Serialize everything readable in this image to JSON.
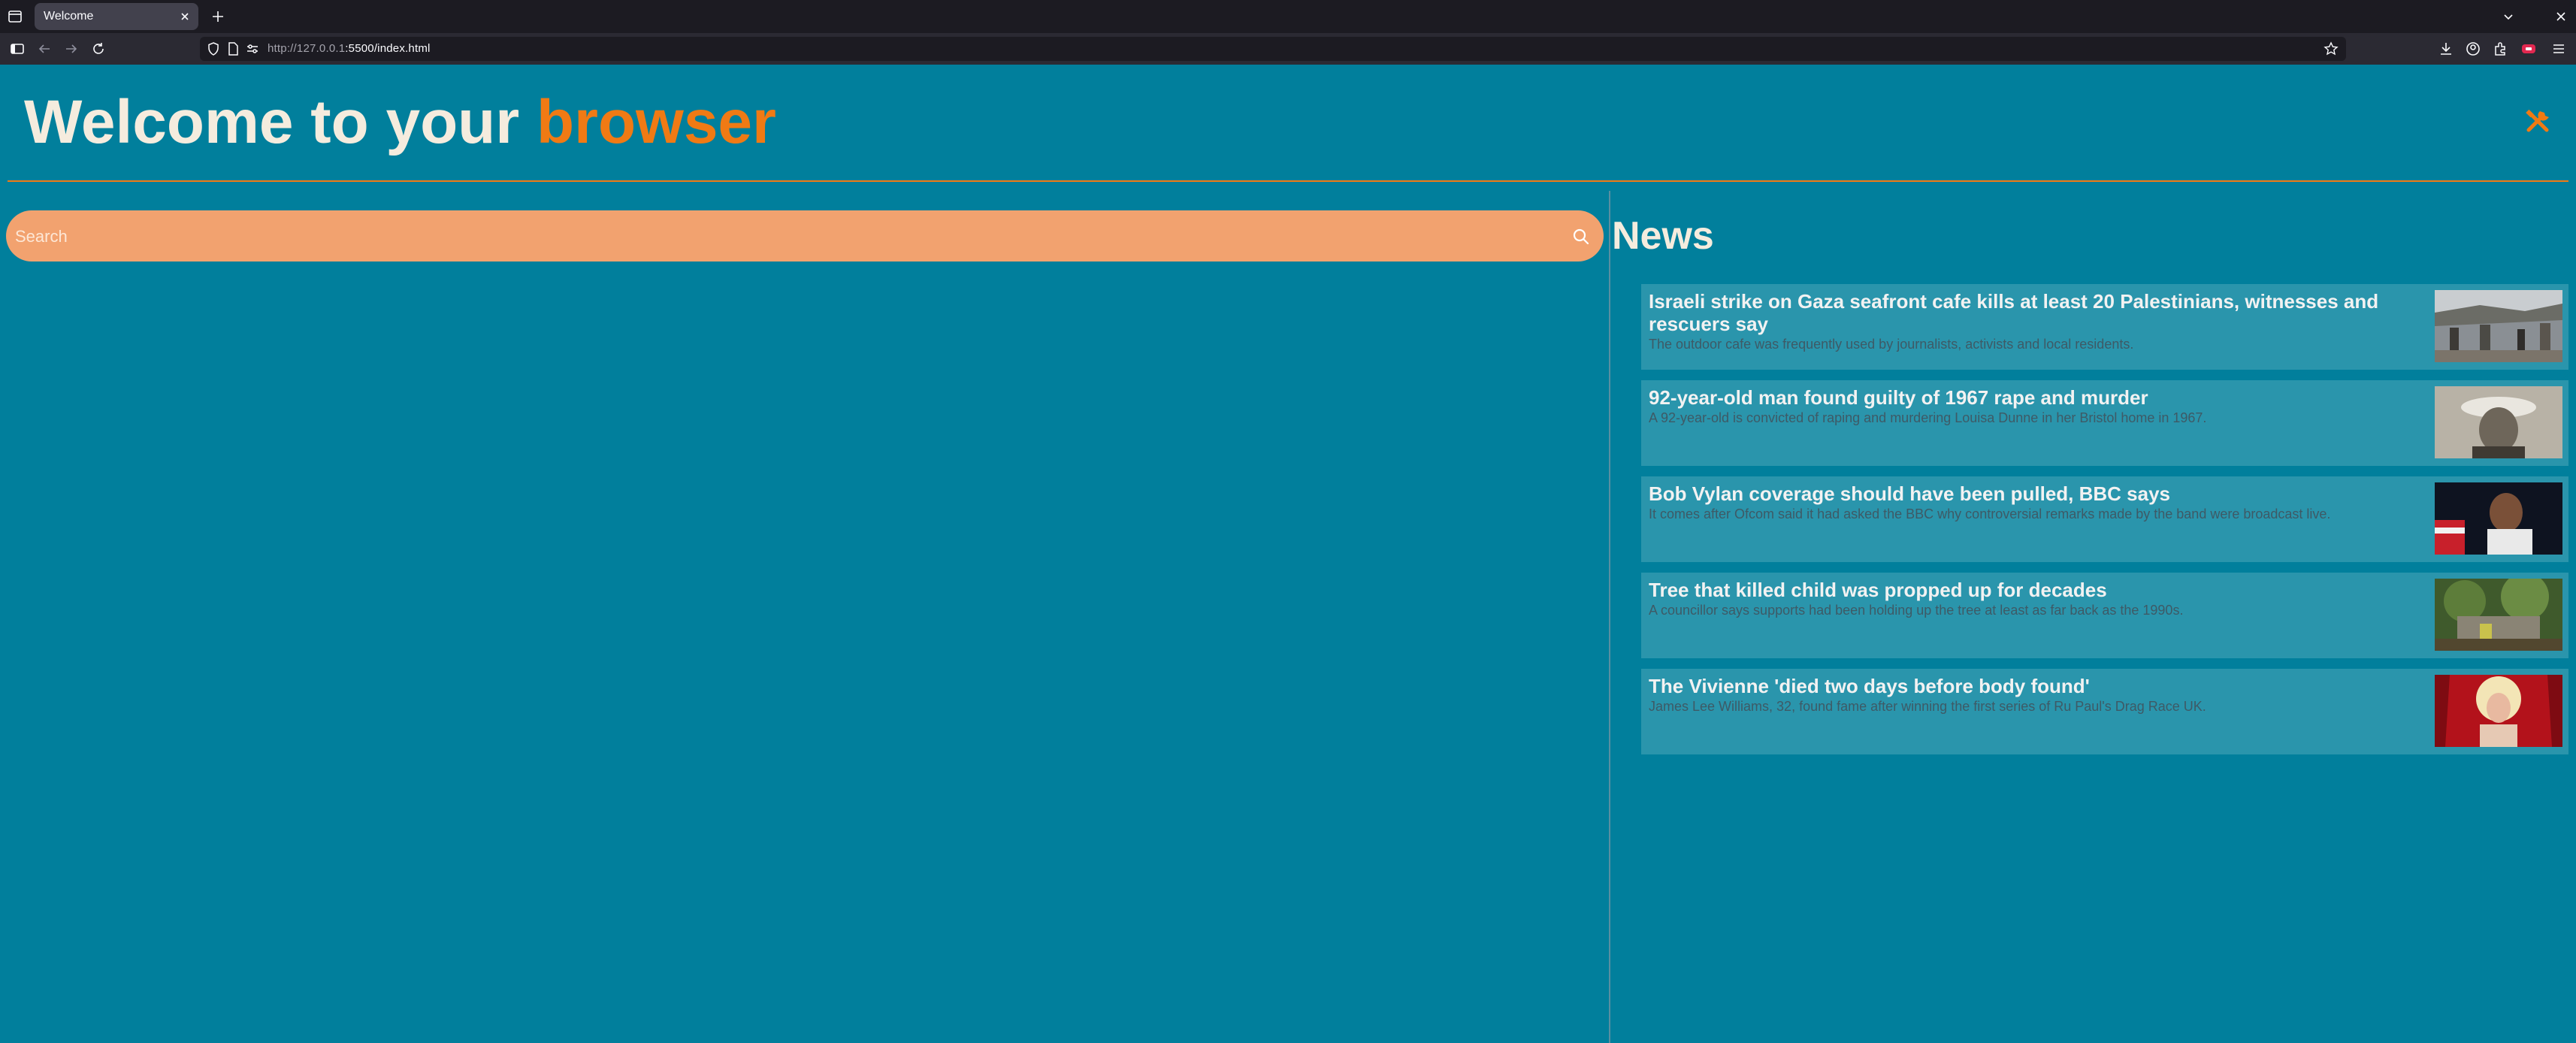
{
  "browser": {
    "tab_title": "Welcome",
    "url_host": "http://127.0.0.1",
    "url_rest": ":5500/index.html"
  },
  "header": {
    "title_prefix": "Welcome to your ",
    "title_accent": "browser"
  },
  "search": {
    "placeholder": "Search",
    "value": ""
  },
  "news": {
    "title": "News",
    "items": [
      {
        "headline": "Israeli strike on Gaza seafront cafe kills at least 20 Palestinians, witnesses and rescuers say",
        "summary": "The outdoor cafe was frequently used by journalists, activists and local residents."
      },
      {
        "headline": "92-year-old man found guilty of 1967 rape and murder",
        "summary": "A 92-year-old is convicted of raping and murdering Louisa Dunne in her Bristol home in 1967."
      },
      {
        "headline": "Bob Vylan coverage should have been pulled, BBC says",
        "summary": "It comes after Ofcom said it had asked the BBC why controversial remarks made by the band were broadcast live."
      },
      {
        "headline": "Tree that killed child was propped up for decades",
        "summary": "A councillor says supports had been holding up the tree at least as far back as the 1990s."
      },
      {
        "headline": "The Vivienne 'died two days before body found'",
        "summary": "James Lee Williams, 32, found fame after winning the first series of Ru Paul's Drag Race UK."
      }
    ]
  },
  "colors": {
    "page_bg": "#017f9c",
    "accent": "#f07a14",
    "search_bg": "#f2a26f",
    "card_bg": "#2a95ac"
  }
}
